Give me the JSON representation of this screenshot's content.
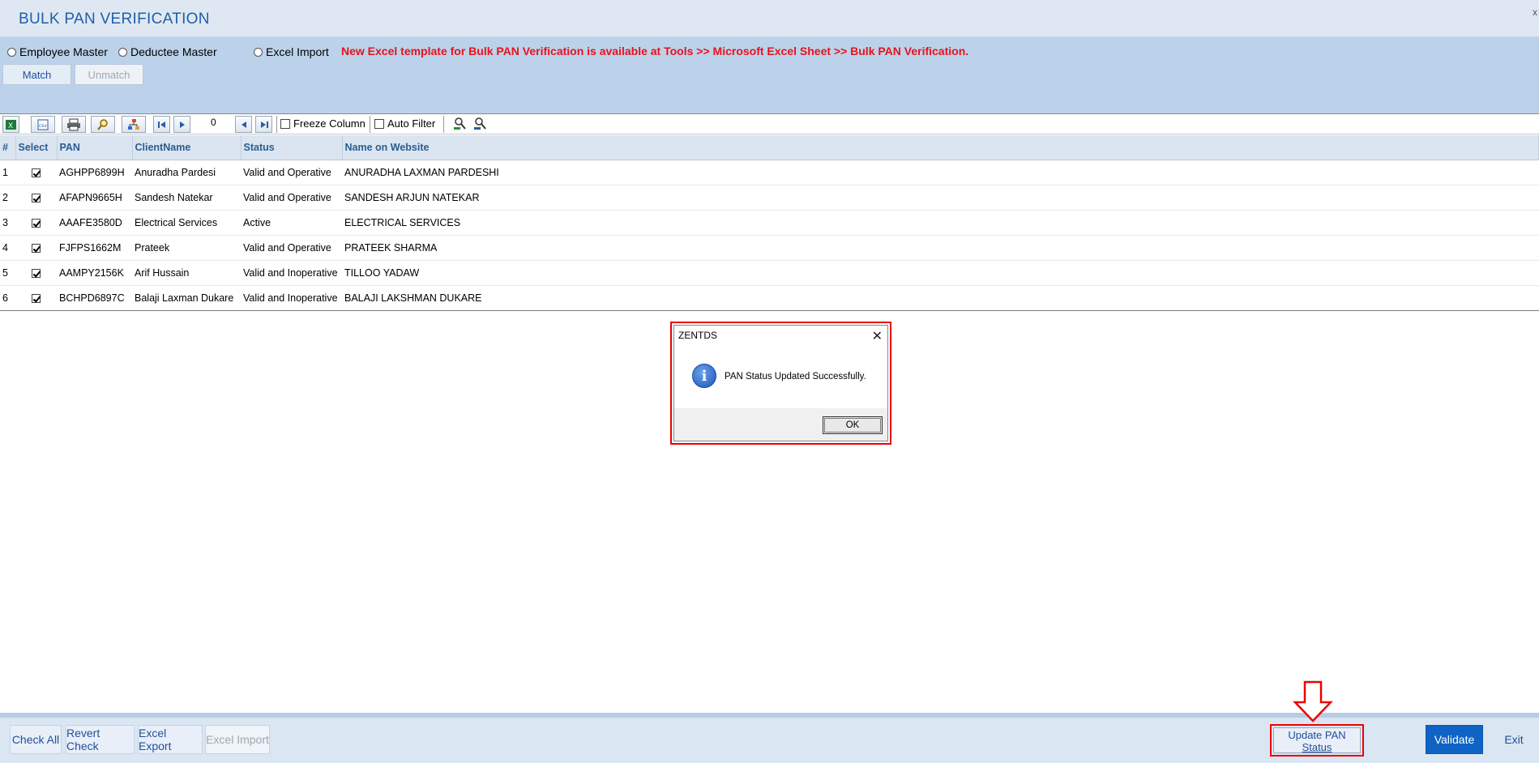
{
  "window": {
    "title": "BULK PAN VERIFICATION",
    "close_glyph": "x"
  },
  "options": {
    "radios": [
      "Employee Master",
      "Deductee Master",
      "Excel Import"
    ],
    "notice": "New Excel template for Bulk PAN Verification is available at Tools >> Microsoft Excel Sheet >> Bulk PAN Verification.",
    "match_label": "Match",
    "unmatch_label": "Unmatch"
  },
  "toolbar": {
    "count": "0",
    "freeze_column": "Freeze Column",
    "auto_filter": "Auto Filter"
  },
  "table": {
    "headers": [
      "#",
      "Select",
      "PAN",
      "ClientName",
      "Status",
      "Name on Website"
    ],
    "rows": [
      {
        "n": "1",
        "pan": "AGHPP6899H",
        "client": "Anuradha Pardesi",
        "status": "Valid and Operative",
        "website": "ANURADHA LAXMAN PARDESHI"
      },
      {
        "n": "2",
        "pan": "AFAPN9665H",
        "client": "Sandesh Natekar",
        "status": "Valid and Operative",
        "website": "SANDESH ARJUN NATEKAR"
      },
      {
        "n": "3",
        "pan": "AAAFE3580D",
        "client": "Electrical Services",
        "status": "Active",
        "website": "ELECTRICAL SERVICES"
      },
      {
        "n": "4",
        "pan": "FJFPS1662M",
        "client": "Prateek",
        "status": "Valid and Operative",
        "website": "PRATEEK SHARMA"
      },
      {
        "n": "5",
        "pan": "AAMPY2156K",
        "client": "Arif Hussain",
        "status": "Valid and Inoperative",
        "website": "TILLOO YADAW"
      },
      {
        "n": "6",
        "pan": "BCHPD6897C",
        "client": "Balaji Laxman Dukare",
        "status": "Valid and Inoperative",
        "website": "BALAJI LAKSHMAN DUKARE"
      }
    ]
  },
  "dialog": {
    "title": "ZENTDS",
    "message": "PAN Status Updated Successfully.",
    "ok": "OK",
    "close_glyph": "✕"
  },
  "footer": {
    "check_all": "Check All",
    "revert_check": "Revert Check",
    "excel_export": "Excel Export",
    "excel_import": "Excel Import",
    "update_line1": "Update PAN",
    "update_line2": "Status",
    "validate": "Validate",
    "exit": "Exit"
  },
  "colors": {
    "accent": "#1f5fa8",
    "notice": "#e8121c",
    "highlight": "#ee0000",
    "primary_button": "#0e63c4"
  }
}
